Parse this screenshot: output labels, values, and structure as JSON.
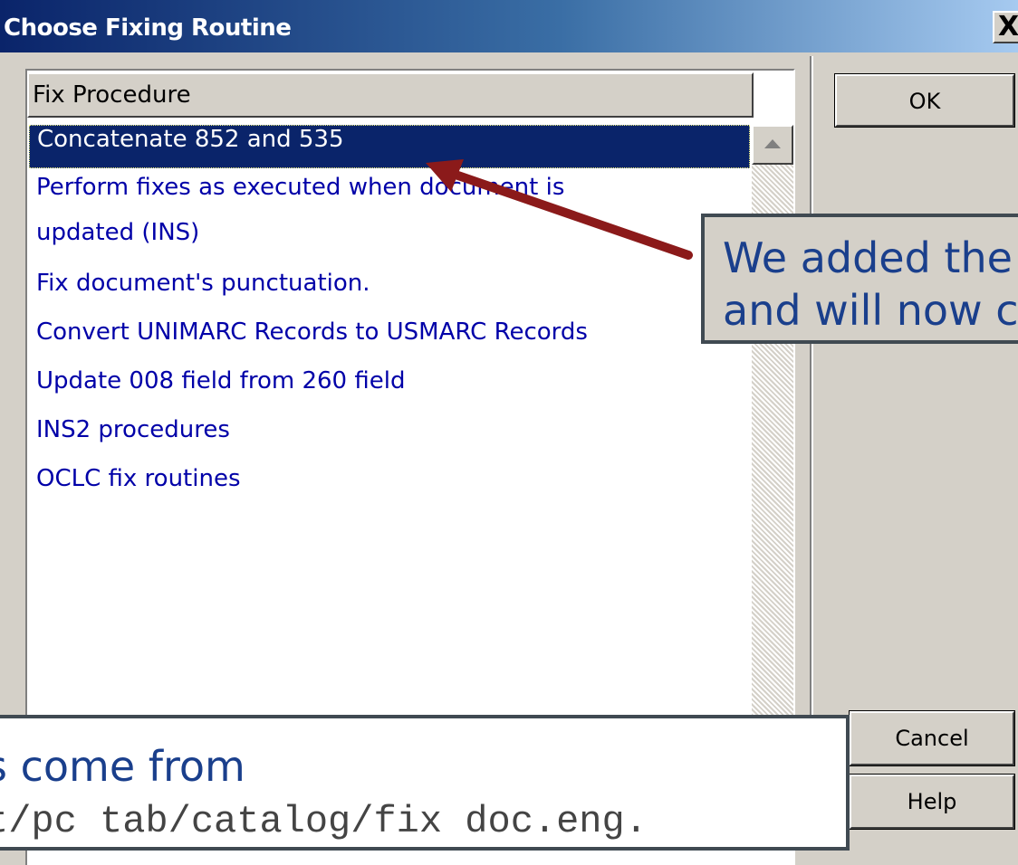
{
  "window": {
    "title": "Choose Fixing Routine",
    "close_label": "X"
  },
  "list": {
    "column_header": "Fix Procedure",
    "items": [
      {
        "label": "Concatenate 852 and 535",
        "selected": true
      },
      {
        "label": "Perform fixes as executed when document is"
      },
      {
        "label": "updated (INS)"
      },
      {
        "label": "Fix document's punctuation."
      },
      {
        "label": "Convert UNIMARC Records to USMARC Records"
      },
      {
        "label": "Update 008 field from 260 field"
      },
      {
        "label": "INS2 procedures"
      },
      {
        "label": "OCLC fix routines"
      }
    ]
  },
  "buttons": {
    "ok": "OK",
    "cancel": "Cancel",
    "help": "Help"
  },
  "annotations": {
    "right_line1": "We added the",
    "right_line2": "and will now c",
    "bottom_line1": "s come from",
    "bottom_line2": "t/pc tab/catalog/fix doc.eng."
  },
  "colors": {
    "title_start": "#0a246a",
    "title_end": "#a6caf0",
    "item_text": "#0000a8",
    "arrow": "#8b1a1a",
    "callout_text": "#1a3f8c"
  }
}
